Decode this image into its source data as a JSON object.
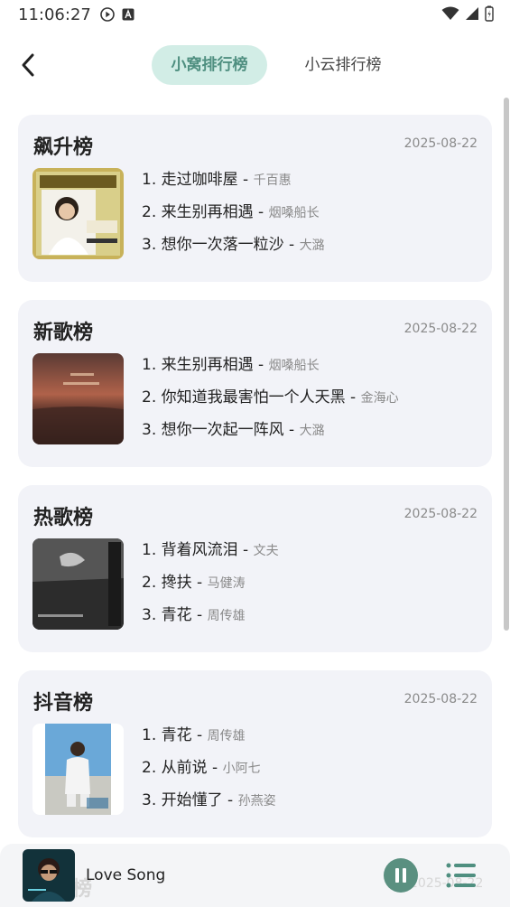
{
  "status_bar": {
    "time": "11:06:27"
  },
  "header": {
    "back_icon": "chevron-left-icon",
    "tabs": [
      {
        "label": "小窝排行榜",
        "active": true
      },
      {
        "label": "小云排行榜",
        "active": false
      }
    ]
  },
  "charts": [
    {
      "title": "飙升榜",
      "date": "2025-08-22",
      "songs": [
        {
          "rank": "1.",
          "name": "走过咖啡屋",
          "artist": "千百惠"
        },
        {
          "rank": "2.",
          "name": "来生别再相遇",
          "artist": "烟嗓船长"
        },
        {
          "rank": "3.",
          "name": "想你一次落一粒沙",
          "artist": "大潞"
        }
      ]
    },
    {
      "title": "新歌榜",
      "date": "2025-08-22",
      "songs": [
        {
          "rank": "1.",
          "name": "来生别再相遇",
          "artist": "烟嗓船长"
        },
        {
          "rank": "2.",
          "name": "你知道我最害怕一个人天黑",
          "artist": "金海心"
        },
        {
          "rank": "3.",
          "name": "想你一次起一阵风",
          "artist": "大潞"
        }
      ]
    },
    {
      "title": "热歌榜",
      "date": "2025-08-22",
      "songs": [
        {
          "rank": "1.",
          "name": "背着风流泪",
          "artist": "文夫"
        },
        {
          "rank": "2.",
          "name": "搀扶",
          "artist": "马健涛"
        },
        {
          "rank": "3.",
          "name": "青花",
          "artist": "周传雄"
        }
      ]
    },
    {
      "title": "抖音榜",
      "date": "2025-08-22",
      "songs": [
        {
          "rank": "1.",
          "name": "青花",
          "artist": "周传雄"
        },
        {
          "rank": "2.",
          "name": "从前说",
          "artist": "小阿七"
        },
        {
          "rank": "3.",
          "name": "开始懂了",
          "artist": "孙燕姿"
        }
      ]
    }
  ],
  "peek": {
    "title_fragment": "榜",
    "date_fragment": "2025-08-22"
  },
  "player": {
    "title": "Love Song",
    "play_icon": "pause-icon",
    "list_icon": "playlist-icon"
  },
  "colors": {
    "accent": "#5a9080",
    "tab_active_bg": "#d2ede6",
    "card_bg": "#f2f3f8"
  }
}
